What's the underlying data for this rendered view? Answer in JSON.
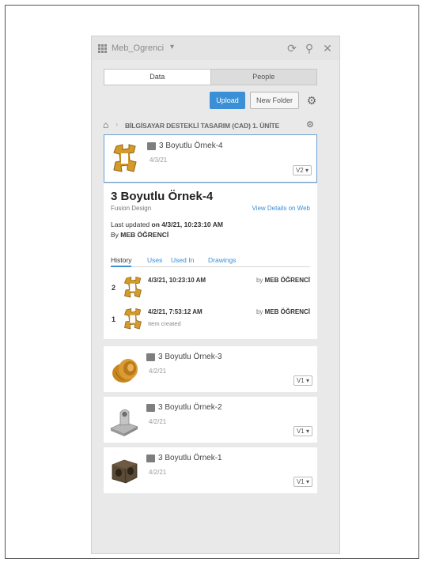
{
  "titlebar": {
    "project": "Meb_Ogrenci",
    "caret": "▾",
    "refresh_icon": "⟳",
    "search_icon": "⚲",
    "close_icon": "✕"
  },
  "tabs": [
    {
      "label": "Data",
      "active": true
    },
    {
      "label": "People",
      "active": false
    }
  ],
  "toolbar": {
    "upload": "Upload",
    "new_folder": "New Folder",
    "gear": "⚙"
  },
  "breadcrumb": {
    "home": "⌂",
    "separator": "›",
    "path": "BİLGİSAYAR DESTEKLİ TASARIM (CAD) 1. ÜNİTE",
    "end_icon": "⚙"
  },
  "items": [
    {
      "name": "3 Boyutlu Örnek-4",
      "date": "4/3/21",
      "version": "V2 ▾"
    },
    {
      "name": "3 Boyutlu Örnek-3",
      "date": "4/2/21",
      "version": "V1 ▾"
    },
    {
      "name": "3 Boyutlu Örnek-2",
      "date": "4/2/21",
      "version": "V1 ▾"
    },
    {
      "name": "3 Boyutlu Örnek-1",
      "date": "4/2/21",
      "version": "V1 ▾"
    }
  ],
  "detail": {
    "title": "3 Boyutlu Örnek-4",
    "subtitle": "Fusion Design",
    "link": "View Details on Web",
    "updated_prefix": "Last updated",
    "updated_value": "on 4/3/21, 10:23:10 AM",
    "by_prefix": "By",
    "by_value": "MEB ÖĞRENCİ",
    "tabs": [
      "History",
      "Uses",
      "Used In",
      "Drawings"
    ],
    "history": [
      {
        "num": "2",
        "time": "4/3/21, 10:23:10 AM",
        "note": "",
        "by_prefix": "by",
        "by_value": "MEB ÖĞRENCİ"
      },
      {
        "num": "1",
        "time": "4/2/21, 7:53:12 AM",
        "note": "Item created",
        "by_prefix": "by",
        "by_value": "MEB ÖĞRENCİ"
      }
    ]
  },
  "colors": {
    "accent": "#3a8fd6",
    "panel_bg": "#e9e9e9",
    "part_orange": "#d49a2a",
    "part_dark": "#5a4a36"
  }
}
